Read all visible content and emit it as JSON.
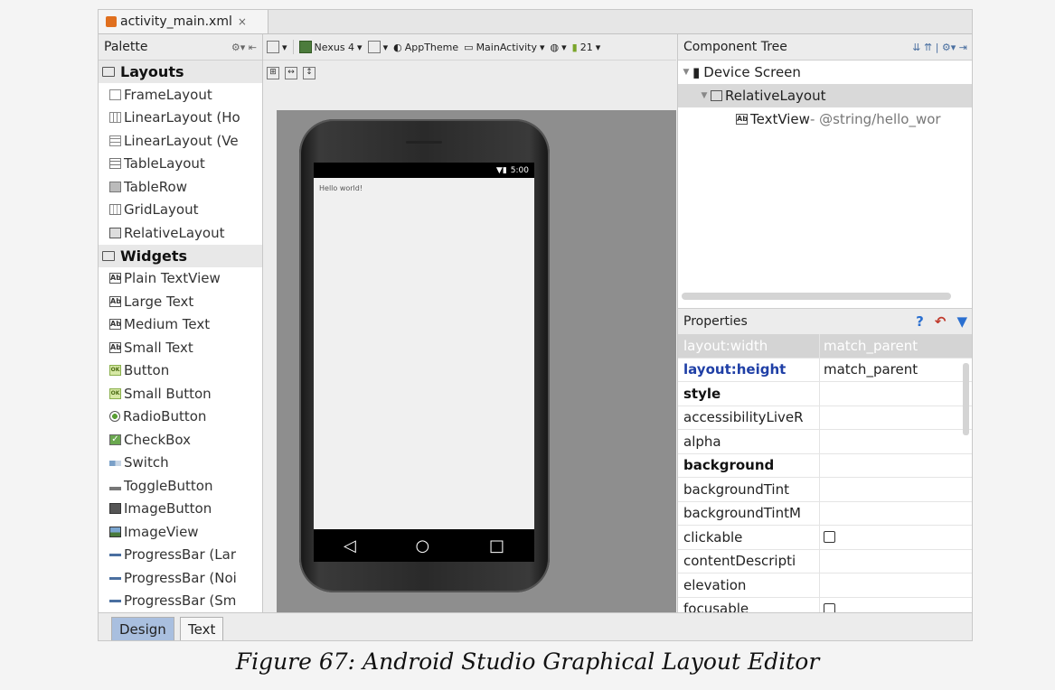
{
  "file_tab": {
    "title": "activity_main.xml",
    "close": "×"
  },
  "palette": {
    "title": "Palette",
    "categories": [
      {
        "label": "Layouts",
        "items": [
          {
            "label": "FrameLayout",
            "icon": "frame"
          },
          {
            "label": "LinearLayout (Ho",
            "icon": "linh"
          },
          {
            "label": "LinearLayout (Ve",
            "icon": "linv"
          },
          {
            "label": "TableLayout",
            "icon": "table"
          },
          {
            "label": "TableRow",
            "icon": "row"
          },
          {
            "label": "GridLayout",
            "icon": "grid"
          },
          {
            "label": "RelativeLayout",
            "icon": "rel"
          }
        ]
      },
      {
        "label": "Widgets",
        "items": [
          {
            "label": "Plain TextView",
            "icon": "ab"
          },
          {
            "label": "Large Text",
            "icon": "ab"
          },
          {
            "label": "Medium Text",
            "icon": "ab"
          },
          {
            "label": "Small Text",
            "icon": "ab"
          },
          {
            "label": "Button",
            "icon": "ok"
          },
          {
            "label": "Small Button",
            "icon": "ok"
          },
          {
            "label": "RadioButton",
            "icon": "radio"
          },
          {
            "label": "CheckBox",
            "icon": "check"
          },
          {
            "label": "Switch",
            "icon": "switch"
          },
          {
            "label": "ToggleButton",
            "icon": "toggle"
          },
          {
            "label": "ImageButton",
            "icon": "imgbtn"
          },
          {
            "label": "ImageView",
            "icon": "imgview"
          },
          {
            "label": "ProgressBar (Lar",
            "icon": "progress"
          },
          {
            "label": "ProgressBar (Noi",
            "icon": "progress"
          },
          {
            "label": "ProgressBar (Sm",
            "icon": "progress"
          }
        ]
      }
    ]
  },
  "toolbar": {
    "device": "Nexus 4",
    "theme": "AppTheme",
    "activity": "MainActivity",
    "api": "21"
  },
  "preview": {
    "status_time": "5:00",
    "hello_text": "Hello world!"
  },
  "component_tree": {
    "title": "Component Tree",
    "nodes": [
      {
        "label": "Device Screen",
        "suffix": ""
      },
      {
        "label": "RelativeLayout",
        "suffix": ""
      },
      {
        "label": "TextView",
        "suffix": " - @string/hello_wor"
      }
    ]
  },
  "properties": {
    "title": "Properties",
    "rows": [
      {
        "key": "layout:width",
        "value": "match_parent",
        "style": "sel"
      },
      {
        "key": "layout:height",
        "value": "match_parent",
        "style": "blue"
      },
      {
        "key": "style",
        "value": "",
        "style": "bold"
      },
      {
        "key": "accessibilityLiveR",
        "value": "",
        "style": ""
      },
      {
        "key": "alpha",
        "value": "",
        "style": ""
      },
      {
        "key": "background",
        "value": "",
        "style": "bold"
      },
      {
        "key": "backgroundTint",
        "value": "",
        "style": ""
      },
      {
        "key": "backgroundTintM",
        "value": "",
        "style": ""
      },
      {
        "key": "clickable",
        "value": "",
        "style": "",
        "checkbox": true
      },
      {
        "key": "contentDescripti",
        "value": "",
        "style": ""
      },
      {
        "key": "elevation",
        "value": "",
        "style": ""
      },
      {
        "key": "focusable",
        "value": "",
        "style": "",
        "checkbox": true
      }
    ]
  },
  "bottom_tabs": {
    "design": "Design",
    "text": "Text"
  },
  "caption": "Figure 67: Android Studio Graphical Layout Editor",
  "colors": {
    "selection": "#d4d4d4",
    "design_tab": "#a9bfdf",
    "property_key_blue": "#1f3fa6"
  }
}
